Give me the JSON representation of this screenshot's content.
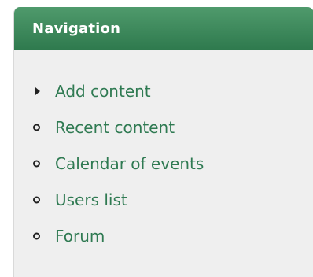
{
  "block": {
    "title": "Navigation",
    "items": [
      {
        "label": "Add content",
        "marker": "collapsed-triangle"
      },
      {
        "label": "Recent content",
        "marker": "bullet"
      },
      {
        "label": "Calendar of events",
        "marker": "bullet"
      },
      {
        "label": "Users list",
        "marker": "bullet"
      },
      {
        "label": "Forum",
        "marker": "bullet"
      }
    ]
  },
  "colors": {
    "header": "#3a8a5b",
    "link": "#2f7a52",
    "background": "#efefef"
  }
}
